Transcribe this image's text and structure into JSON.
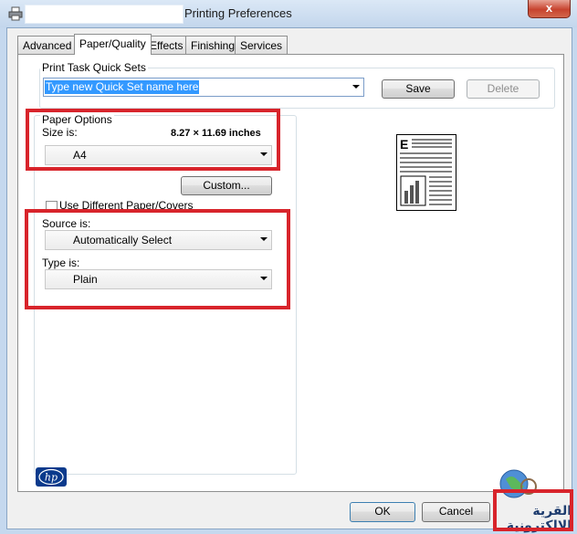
{
  "window": {
    "title": "Printing Preferences",
    "close_symbol": "x"
  },
  "tabs": [
    {
      "label": "Advanced",
      "active": false
    },
    {
      "label": "Paper/Quality",
      "active": true
    },
    {
      "label": "Effects",
      "active": false
    },
    {
      "label": "Finishing",
      "active": false
    },
    {
      "label": "Services",
      "active": false
    }
  ],
  "quick_sets": {
    "group_label": "Print Task Quick Sets",
    "input_value": "Type new Quick Set name here",
    "save_label": "Save",
    "delete_label": "Delete"
  },
  "paper_options": {
    "group_label": "Paper Options",
    "size_label": "Size is:",
    "size_dimensions": "8.27 × 11.69 inches",
    "size_value": "A4",
    "custom_label": "Custom...",
    "different_paper_label": "Use Different Paper/Covers",
    "different_paper_checked": false,
    "source_label": "Source is:",
    "source_value": "Automatically Select",
    "type_label": "Type is:",
    "type_value": "Plain"
  },
  "preview": {
    "icon": "document-preview-icon",
    "letter": "E"
  },
  "brand": {
    "logo_text": "hp"
  },
  "footer": {
    "ok_label": "OK",
    "cancel_label": "Cancel",
    "watermark_text": "القرية الالكترونية"
  },
  "colors": {
    "highlight_red": "#d8242b",
    "selection_blue": "#3399ff",
    "hp_blue": "#0a3a8c"
  }
}
